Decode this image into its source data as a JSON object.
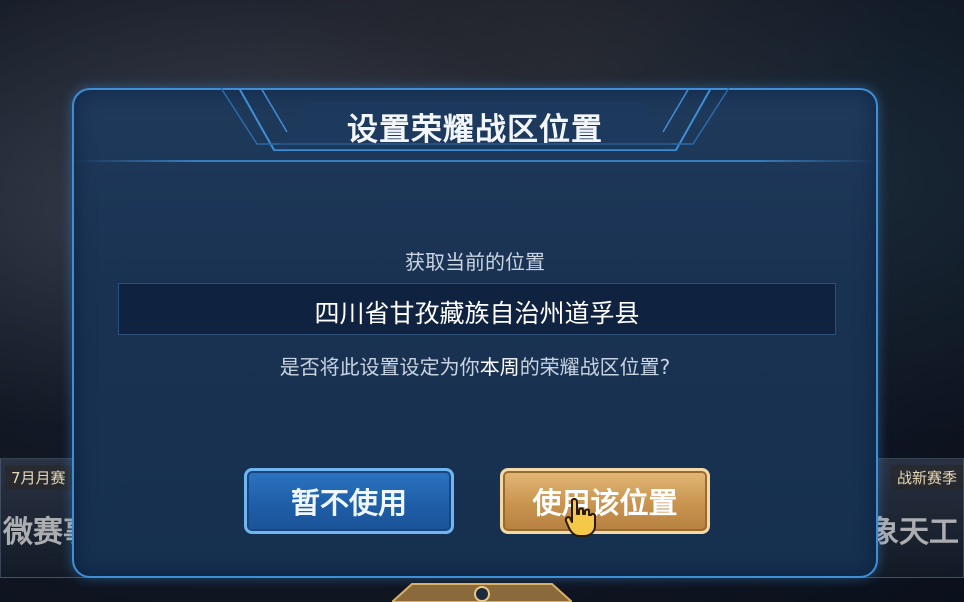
{
  "background": {
    "left_card": {
      "tag": "7月月赛",
      "big": "微赛事"
    },
    "right_card": {
      "tag": "战新赛季",
      "big": "象天工"
    }
  },
  "dialog": {
    "title": "设置荣耀战区位置",
    "subtitle": "获取当前的位置",
    "location": "四川省甘孜藏族自治州道孚县",
    "question_prefix": "是否将此设置设定为你",
    "question_emphasis": "本周",
    "question_suffix": "的荣耀战区位置?",
    "buttons": {
      "cancel": "暂不使用",
      "confirm": "使用该位置"
    }
  },
  "colors": {
    "dialog_border": "#3e8fd6",
    "cancel_button": "#1f5ea8",
    "confirm_button": "#c99450",
    "cursor": "#f5c84a"
  },
  "icons": {
    "cursor": "pointer-hand-icon"
  }
}
